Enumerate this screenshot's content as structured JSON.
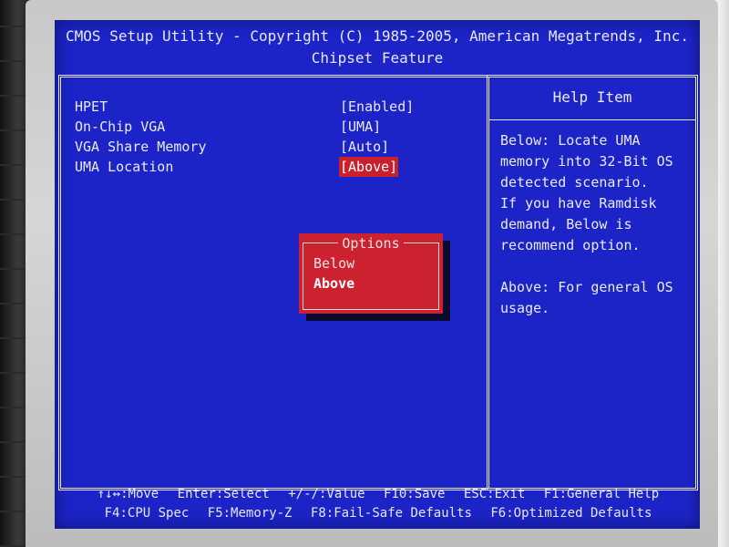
{
  "header": {
    "line1": "CMOS Setup Utility - Copyright (C) 1985-2005, American Megatrends, Inc.",
    "line2": "Chipset Feature"
  },
  "settings": [
    {
      "label": "HPET",
      "value": "[Enabled]"
    },
    {
      "label": "On-Chip VGA",
      "value": "[UMA]"
    },
    {
      "label": "VGA Share Memory",
      "value": "[Auto]"
    },
    {
      "label": "UMA Location",
      "value": "[Above]",
      "selected": true
    }
  ],
  "help": {
    "title": "Help Item",
    "lines": [
      "Below: Locate UMA",
      "memory into 32-Bit OS",
      "detected scenario.",
      "If you have Ramdisk",
      "demand, Below is",
      "recommend option.",
      "",
      "Above: For general OS",
      "usage."
    ]
  },
  "options_popup": {
    "title": "Options",
    "items": [
      "Below",
      "Above"
    ],
    "highlighted": "Above"
  },
  "footer": {
    "row1": [
      "↑↓↔:Move",
      "Enter:Select",
      "+/-/:Value",
      "F10:Save",
      "ESC:Exit",
      "F1:General Help"
    ],
    "row2": [
      "F4:CPU Spec",
      "F5:Memory-Z",
      "F8:Fail-Safe Defaults",
      "F6:Optimized Defaults"
    ]
  },
  "colors": {
    "screen_blue": "#1c24c8",
    "highlight_red": "#c8202c",
    "text": "#e8eaf5"
  }
}
